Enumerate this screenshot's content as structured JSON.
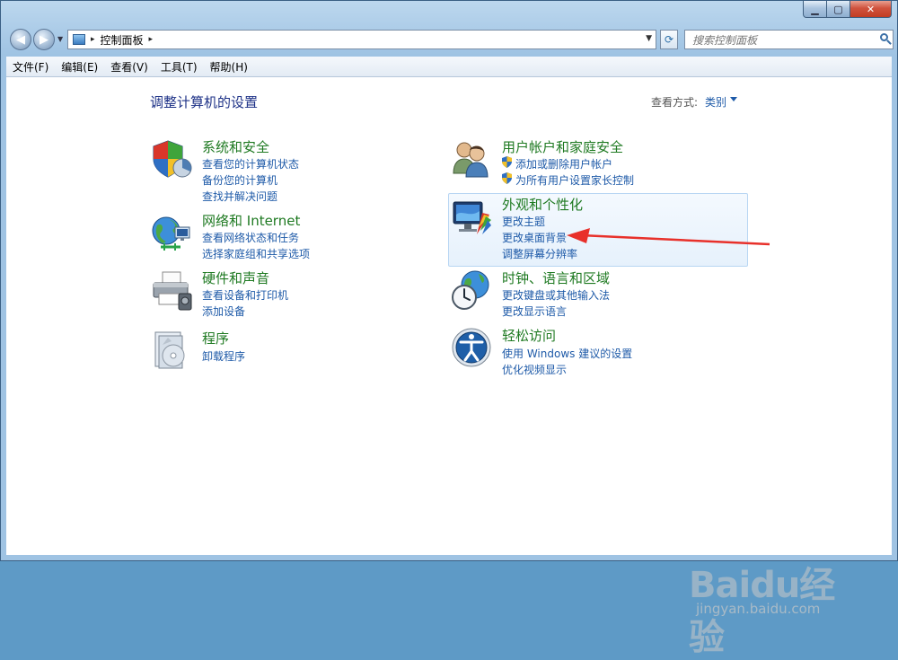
{
  "window": {
    "caption_buttons": {
      "minimize": "▁",
      "maximize": "▢",
      "close": "✕"
    }
  },
  "navbar": {
    "back_glyph": "◀",
    "forward_glyph": "▶",
    "address_path": "控制面板",
    "address_sep": "▸",
    "search_placeholder": "搜索控制面板"
  },
  "menu": [
    "文件(F)",
    "编辑(E)",
    "查看(V)",
    "工具(T)",
    "帮助(H)"
  ],
  "content": {
    "title": "调整计算机的设置",
    "view_by_label": "查看方式:",
    "view_by_value": "类别"
  },
  "categories": {
    "system": {
      "title": "系统和安全",
      "icon": "shield-icon",
      "links": [
        "查看您的计算机状态",
        "备份您的计算机",
        "查找并解决问题"
      ]
    },
    "network": {
      "title": "网络和 Internet",
      "icon": "network-globe-icon",
      "links": [
        "查看网络状态和任务",
        "选择家庭组和共享选项"
      ]
    },
    "hardware": {
      "title": "硬件和声音",
      "icon": "printer-icon",
      "links": [
        "查看设备和打印机",
        "添加设备"
      ]
    },
    "programs": {
      "title": "程序",
      "icon": "programs-disc-icon",
      "links": [
        "卸载程序"
      ]
    },
    "users": {
      "title": "用户帐户和家庭安全",
      "icon": "users-icon",
      "links": [
        "添加或删除用户帐户",
        "为所有用户设置家长控制"
      ]
    },
    "appearance": {
      "title": "外观和个性化",
      "icon": "display-palette-icon",
      "links": [
        "更改主题",
        "更改桌面背景",
        "调整屏幕分辨率"
      ]
    },
    "clock": {
      "title": "时钟、语言和区域",
      "icon": "clock-globe-icon",
      "links": [
        "更改键盘或其他输入法",
        "更改显示语言"
      ]
    },
    "access": {
      "title": "轻松访问",
      "icon": "ease-of-access-icon",
      "links": [
        "使用 Windows 建议的设置",
        "优化视频显示"
      ]
    }
  },
  "annotation": {
    "arrow_color": "#e8302a"
  },
  "watermark": {
    "main": "Baidu经验",
    "sub": "jingyan.baidu.com"
  }
}
